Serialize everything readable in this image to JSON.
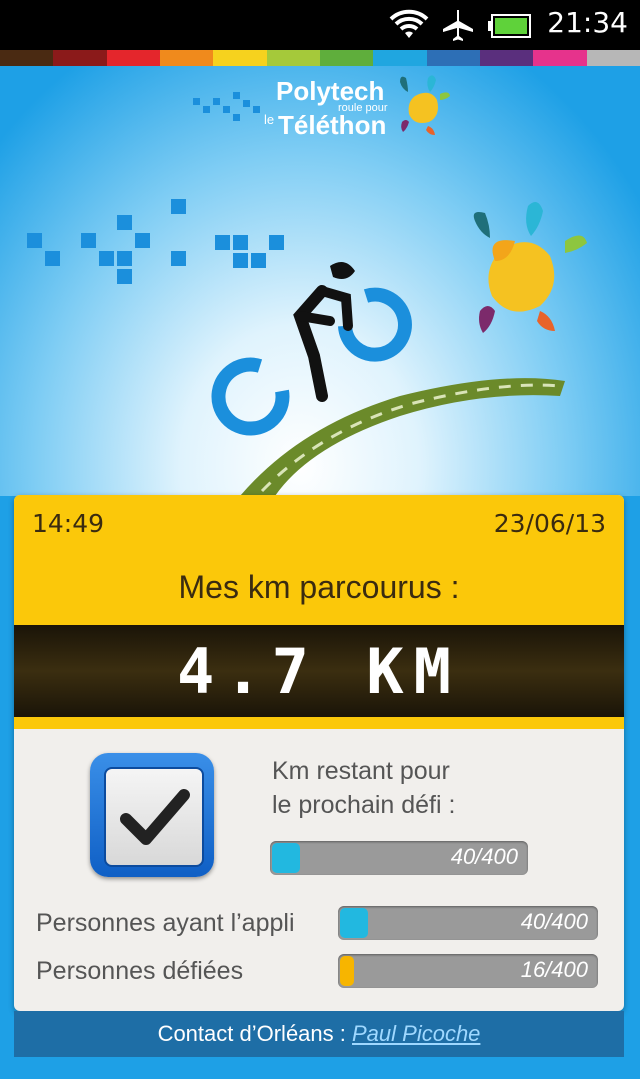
{
  "status_bar": {
    "time": "21:34",
    "icons": [
      "wifi-icon",
      "airplane-icon",
      "battery-icon"
    ]
  },
  "color_strip": [
    "#4a2a12",
    "#8b1a1a",
    "#e4262c",
    "#f08a1c",
    "#f6d21e",
    "#a5c93a",
    "#5fae3c",
    "#20a6e0",
    "#2d6fb6",
    "#5a2f7d",
    "#e6338c",
    "#b7b7b7"
  ],
  "header": {
    "logo_line1": "Polytech",
    "logo_line2": "roule pour",
    "logo_line3": "le",
    "logo_line4": "Téléthon"
  },
  "card": {
    "time": "14:49",
    "date": "23/06/13",
    "title": "Mes km parcourus :",
    "distance": "4.7 KM",
    "next_challenge_label": "Km restant pour le prochain défi :",
    "next_challenge_label_line1": "Km restant pour",
    "next_challenge_label_line2": "le prochain défi :",
    "next_challenge_value": "40/400",
    "next_challenge_progress": 0.1,
    "users_label": "Personnes ayant l’appli",
    "users_value": "40/400",
    "users_progress": 0.1,
    "challenged_label": "Personnes défiées",
    "challenged_value": "16/400",
    "challenged_progress": 0.04
  },
  "contact": {
    "label": "Contact d’Orléans :",
    "name": "Paul Picoche"
  },
  "colors": {
    "background": "#1ea0e6",
    "card_yellow": "#fbc80a",
    "progress_cyan": "#22b8e0",
    "progress_orange": "#f7b500"
  }
}
